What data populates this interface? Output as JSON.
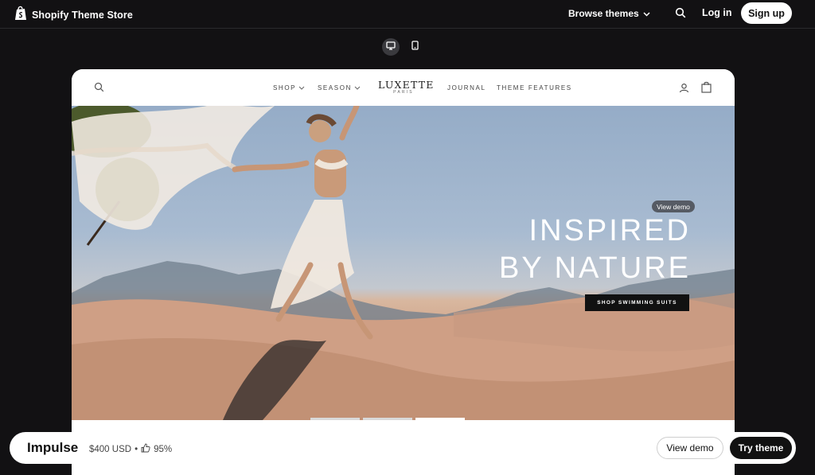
{
  "topbar": {
    "brand": "Shopify Theme Store",
    "browse_label": "Browse themes",
    "login_label": "Log in",
    "signup_label": "Sign up",
    "icons": [
      "shopify-bag-icon",
      "chevron-down-icon",
      "search-icon"
    ]
  },
  "device_toggle": {
    "options": [
      "desktop",
      "mobile"
    ],
    "selected": "desktop"
  },
  "store": {
    "nav_left": [
      "SHOP",
      "SEASON"
    ],
    "logo_main": "LUXETTE",
    "logo_sub": "PARIS",
    "nav_right": [
      "JOURNAL",
      "THEME FEATURES"
    ]
  },
  "hero": {
    "view_demo_badge": "View demo",
    "headline_line1": "INSPIRED",
    "headline_line2": "BY NATURE",
    "cta": "SHOP SWIMMING SUITS",
    "slides_count": 3,
    "active_slide": 3
  },
  "bottombar": {
    "theme_name": "Impulse",
    "price": "$400 USD",
    "separator": "•",
    "rating": "95%",
    "view_demo_label": "View demo",
    "try_theme_label": "Try theme"
  },
  "colors": {
    "page_bg": "#121113",
    "accent_dark": "#111111",
    "hero_sky": "#a8bbd1",
    "hero_sand": "#cfa085"
  }
}
